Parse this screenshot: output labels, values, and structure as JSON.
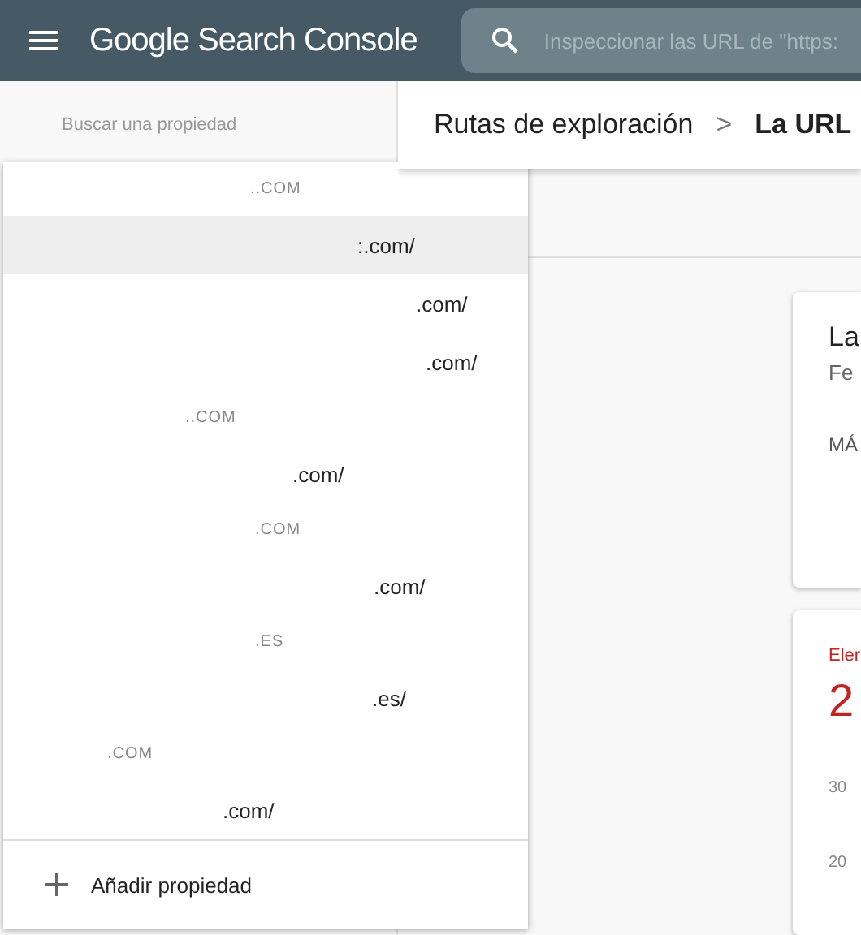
{
  "app_bar": {
    "title": "Google Search Console",
    "search_placeholder": "Inspeccionar las URL de \"https:"
  },
  "sidebar": {
    "search_placeholder": "Buscar una propiedad"
  },
  "property_menu": {
    "entries": [
      {
        "kind": "group",
        "label": "..COM"
      },
      {
        "kind": "property",
        "label": ":.com/",
        "selected": true
      },
      {
        "kind": "property",
        "label": ".com/",
        "selected": false
      },
      {
        "kind": "property",
        "label": ".com/",
        "selected": false
      },
      {
        "kind": "group",
        "label": "..COM"
      },
      {
        "kind": "property",
        "label": ".com/",
        "selected": false
      },
      {
        "kind": "group",
        "label": ".COM"
      },
      {
        "kind": "property",
        "label": ".com/",
        "selected": false
      },
      {
        "kind": "group",
        "label": ".ES"
      },
      {
        "kind": "property",
        "label": ".es/",
        "selected": false
      },
      {
        "kind": "group",
        "label": ".COM"
      },
      {
        "kind": "property",
        "label": ".com/",
        "selected": false
      }
    ],
    "add_label": "Añadir propiedad"
  },
  "breadcrumb": {
    "parent": "Rutas de exploración",
    "separator": ">",
    "current": "La URL"
  },
  "cards": [
    {
      "title": "La",
      "subtitle": "Fe",
      "link": "MÁ"
    },
    {
      "label": "Eler",
      "value": "2",
      "ticks": [
        "30",
        "20"
      ]
    }
  ]
}
